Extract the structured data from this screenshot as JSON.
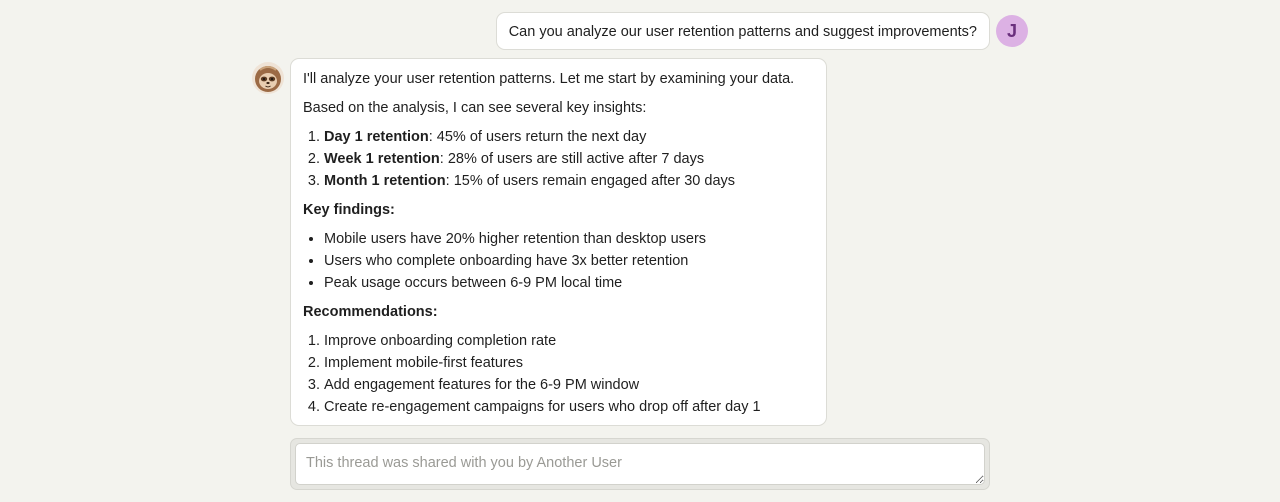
{
  "user_message": {
    "text": "Can you analyze our user retention patterns and suggest improvements?",
    "avatar_initial": "J",
    "avatar_color": "#dcb1e4"
  },
  "assistant_message": {
    "avatar_icon": "sloth-avatar-icon",
    "intro": "I'll analyze your user retention patterns. Let me start by examining your data.",
    "analysis_intro": "Based on the analysis, I can see several key insights:",
    "metrics": [
      {
        "label": "Day 1 retention",
        "value": ": 45% of users return the next day"
      },
      {
        "label": "Week 1 retention",
        "value": ": 28% of users are still active after 7 days"
      },
      {
        "label": "Month 1 retention",
        "value": ": 15% of users remain engaged after 30 days"
      }
    ],
    "findings_heading": "Key findings:",
    "findings": [
      "Mobile users have 20% higher retention than desktop users",
      "Users who complete onboarding have 3x better retention",
      "Peak usage occurs between 6-9 PM local time"
    ],
    "recommendations_heading": "Recommendations:",
    "recommendations": [
      "Improve onboarding completion rate",
      "Implement mobile-first features",
      "Add engagement features for the 6-9 PM window",
      "Create re-engagement campaigns for users who drop off after day 1"
    ]
  },
  "composer": {
    "placeholder": "This thread was shared with you by Another User"
  }
}
